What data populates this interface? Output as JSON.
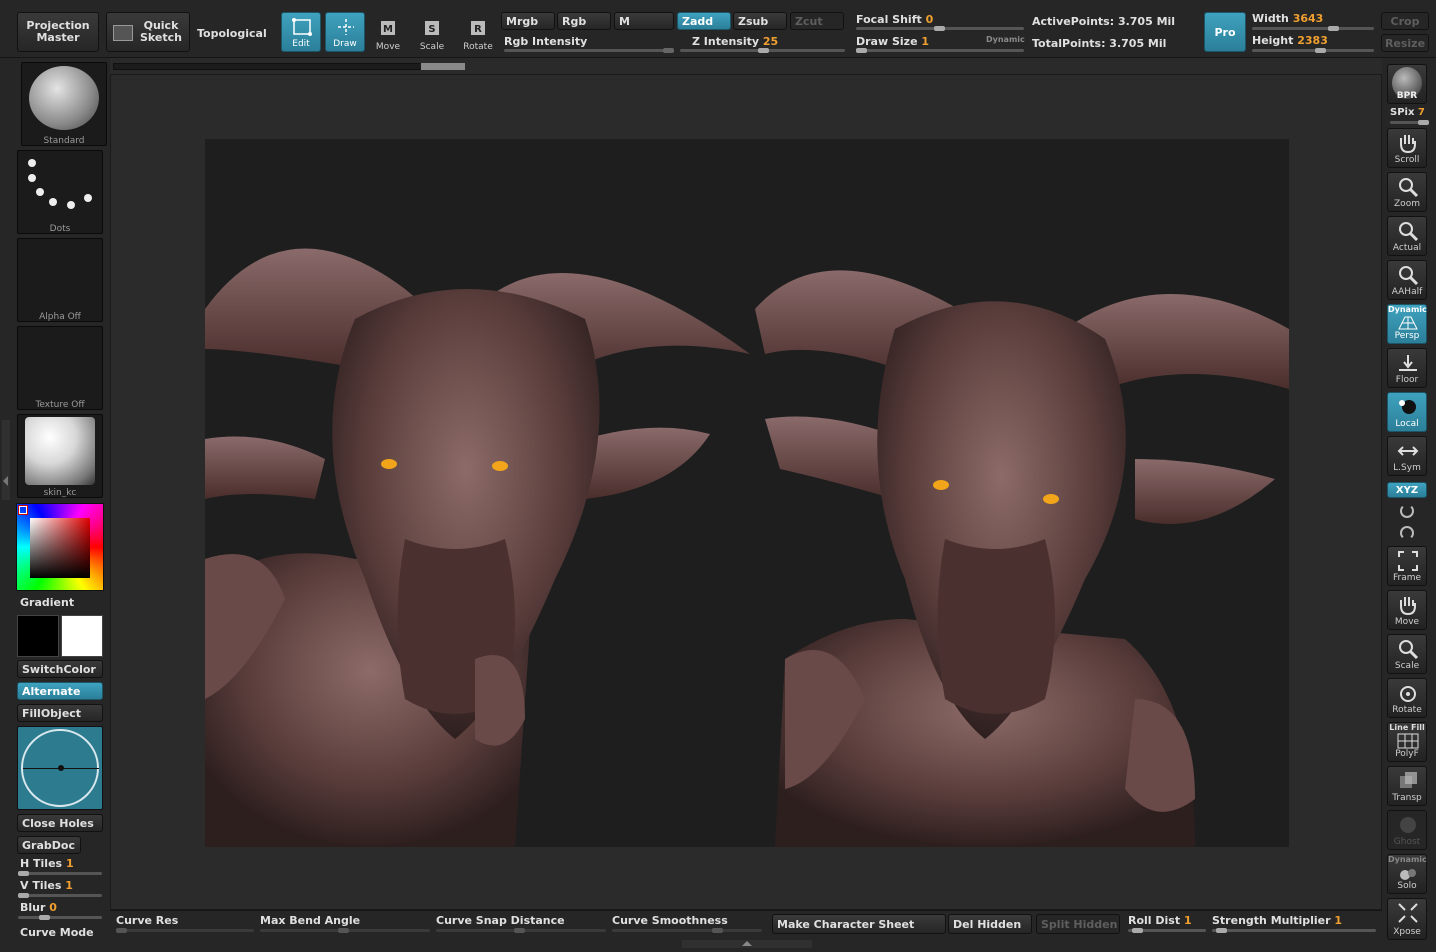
{
  "toolbar": {
    "projection_master": "Projection Master",
    "quick_sketch": "Quick Sketch",
    "topological": "Topological",
    "edit": "Edit",
    "draw": "Draw",
    "move": "Move",
    "scale": "Scale",
    "rotate": "Rotate",
    "mrgb": "Mrgb",
    "rgb": "Rgb",
    "m": "M",
    "zadd": "Zadd",
    "zsub": "Zsub",
    "zcut": "Zcut",
    "rgb_intensity": "Rgb Intensity",
    "z_intensity_label": "Z Intensity",
    "z_intensity_value": "25",
    "focal_shift_label": "Focal Shift",
    "focal_shift_value": "0",
    "draw_size_label": "Draw Size",
    "draw_size_value": "1",
    "dynamic": "Dynamic",
    "active_points": "ActivePoints: 3.705 Mil",
    "total_points": "TotalPoints: 3.705 Mil",
    "pro": "Pro",
    "width_label": "Width",
    "width_value": "3643",
    "height_label": "Height",
    "height_value": "2383",
    "crop": "Crop",
    "resize": "Resize"
  },
  "left_panel": {
    "brush": "Standard",
    "stroke": "Dots",
    "alpha": "Alpha Off",
    "texture": "Texture Off",
    "material": "skin_kc",
    "gradient": "Gradient",
    "switch_color": "SwitchColor",
    "alternate": "Alternate",
    "fill_object": "FillObject",
    "close_holes": "Close Holes",
    "grabdoc": "GrabDoc",
    "h_tiles_label": "H Tiles",
    "h_tiles_value": "1",
    "v_tiles_label": "V Tiles",
    "v_tiles_value": "1",
    "blur_label": "Blur",
    "blur_value": "0",
    "curve_mode": "Curve Mode"
  },
  "right_shelf": {
    "bpr": "BPR",
    "spix_label": "SPix",
    "spix_value": "7",
    "scroll": "Scroll",
    "zoom": "Zoom",
    "actual": "Actual",
    "aahalf": "AAHalf",
    "dynamic": "Dynamic",
    "persp": "Persp",
    "floor": "Floor",
    "local": "Local",
    "lsym": "L.Sym",
    "xyz": "XYZ",
    "frame": "Frame",
    "move": "Move",
    "scale": "Scale",
    "rotate": "Rotate",
    "line_fill": "Line Fill",
    "polyf": "PolyF",
    "transp": "Transp",
    "ghost": "Ghost",
    "dynamic2": "Dynamic",
    "solo": "Solo",
    "xpose": "Xpose"
  },
  "bottom_bar": {
    "curve_res": "Curve Res",
    "max_bend_angle": "Max Bend Angle",
    "curve_snap_distance": "Curve Snap Distance",
    "curve_smoothness": "Curve Smoothness",
    "make_character_sheet": "Make Character Sheet",
    "del_hidden": "Del Hidden",
    "split_hidden": "Split Hidden",
    "roll_dist_label": "Roll Dist",
    "roll_dist_value": "1",
    "strength_multiplier_label": "Strength Multiplier",
    "strength_multiplier_value": "1"
  },
  "colors": {
    "accent": "#3a96b4",
    "value_orange": "#f0a030",
    "canvas_bg": "#2b2b2b",
    "document_bg": "#1e1e1e"
  }
}
